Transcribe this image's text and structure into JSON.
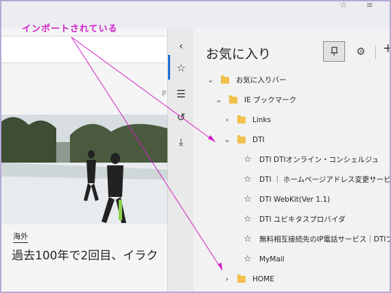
{
  "annotation": "インポートされている",
  "left_pane": {
    "partial_char": "P",
    "news_category": "海外",
    "news_title": "過去100年で2回目、イラク"
  },
  "hub_strip": {
    "collapse_icon": "chevron-left-icon",
    "favorites_icon": "star-list-icon",
    "reading_list_icon": "reading-list-icon",
    "history_icon": "history-icon",
    "downloads_icon": "download-icon"
  },
  "panel": {
    "title": "お気に入り",
    "pin_icon": "pin-icon",
    "settings_icon": "gear-icon",
    "add_label": "+"
  },
  "tree": [
    {
      "label": "お気に入りバー",
      "kind": "folder",
      "expanded": true,
      "level": 0
    },
    {
      "label": "IE ブックマーク",
      "kind": "folder",
      "expanded": true,
      "level": 1
    },
    {
      "label": "Links",
      "kind": "folder",
      "expanded": false,
      "level": 2
    },
    {
      "label": "DTI",
      "kind": "folder",
      "expanded": true,
      "level": 2
    },
    {
      "label": "DTI  DTIオンライン・コンシェルジュ",
      "kind": "link",
      "level": 3
    },
    {
      "label": "DTI ｜ ホームページアドレス変更サービス",
      "kind": "link",
      "level": 3
    },
    {
      "label": "DTI WebKit(Ver 1.1)",
      "kind": "link",
      "level": 3
    },
    {
      "label": "DTI ユビキタスプロバイダ",
      "kind": "link",
      "level": 3
    },
    {
      "label": "無料相互接続先のIP電話サービス｜DTIブ",
      "kind": "link",
      "level": 3
    },
    {
      "label": "MyMail",
      "kind": "link",
      "level": 3
    },
    {
      "label": "HOME",
      "kind": "folder",
      "expanded": false,
      "level": 2
    }
  ],
  "colors": {
    "annotation": "#d21fc8",
    "accent": "#1a6fd6",
    "folder": "#f2c14c"
  }
}
